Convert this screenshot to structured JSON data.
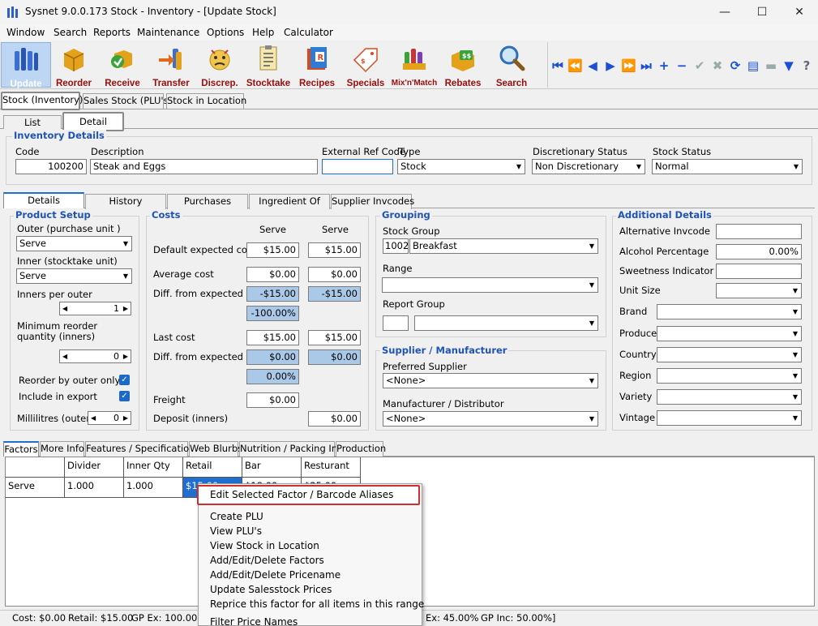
{
  "window": {
    "title": "Sysnet 9.0.0.173 Stock - Inventory - [Update Stock]"
  },
  "menu": [
    "Window",
    "Search",
    "Reports",
    "Maintenance",
    "Options",
    "Help",
    "Calculator"
  ],
  "toolbar": [
    {
      "label": "Update",
      "icon": "update-icon"
    },
    {
      "label": "Reorder",
      "icon": "reorder-icon"
    },
    {
      "label": "Receive",
      "icon": "receive-icon"
    },
    {
      "label": "Transfer",
      "icon": "transfer-icon"
    },
    {
      "label": "Discrep.",
      "icon": "discrepancy-icon"
    },
    {
      "label": "Stocktake",
      "icon": "stocktake-icon"
    },
    {
      "label": "Recipes",
      "icon": "recipes-icon"
    },
    {
      "label": "Specials",
      "icon": "specials-icon"
    },
    {
      "label": "Mix'n'Match",
      "icon": "mixnmatch-icon"
    },
    {
      "label": "Rebates",
      "icon": "rebates-icon"
    },
    {
      "label": "Search",
      "icon": "search-icon"
    }
  ],
  "nav_icons": [
    "first-icon",
    "prev-page-icon",
    "prev-icon",
    "next-icon",
    "next-page-icon",
    "last-icon",
    "add-icon",
    "delete-icon",
    "confirm-icon",
    "cancel-icon",
    "refresh-icon",
    "book-icon",
    "notes-icon",
    "filter-icon",
    "help-icon"
  ],
  "main_tabs": [
    "Stock (Inventory)",
    "Sales Stock (PLU's)",
    "Stock in Location"
  ],
  "sub_tabs": [
    "List",
    "Detail"
  ],
  "inventory_details": {
    "title": "Inventory Details",
    "code_label": "Code",
    "code": "100200",
    "desc_label": "Description",
    "desc": "Steak and Eggs",
    "extref_label": "External Ref Code",
    "extref": "",
    "type_label": "Type",
    "type": "Stock",
    "disc_label": "Discretionary Status",
    "disc": "Non Discretionary",
    "status_label": "Stock Status",
    "status": "Normal"
  },
  "detail_tabs": [
    "Details",
    "History",
    "Purchases",
    "Ingredient Of",
    "Supplier Invcodes"
  ],
  "product_setup": {
    "title": "Product Setup",
    "outer_label": "Outer (purchase unit )",
    "outer": "Serve",
    "inner_label": "Inner (stocktake unit)",
    "inner": "Serve",
    "inners_label": "Inners per outer",
    "inners": "1",
    "minreorder_label1": "Minimum reorder",
    "minreorder_label2": "quantity (inners)",
    "minreorder": "0",
    "reorder_outer_label": "Reorder by outer only",
    "include_export_label": "Include in export",
    "ml_label": "Millilitres (outer)",
    "ml": "0"
  },
  "costs": {
    "title": "Costs",
    "col1": "Serve",
    "col2": "Serve",
    "default_label": "Default expected cost",
    "default1": "$15.00",
    "default2": "$15.00",
    "avg_label": "Average cost",
    "avg1": "$0.00",
    "avg2": "$0.00",
    "diff1_label": "Diff. from expected",
    "diff1a": "-$15.00",
    "diff1b": "-$15.00",
    "diff1pct": "-100.00%",
    "last_label": "Last cost",
    "last1": "$15.00",
    "last2": "$15.00",
    "diff2_label": "Diff. from expected",
    "diff2a": "$0.00",
    "diff2b": "$0.00",
    "diff2pct": "0.00%",
    "freight_label": "Freight",
    "freight": "$0.00",
    "deposit_label": "Deposit (inners)",
    "deposit": "$0.00"
  },
  "grouping": {
    "title": "Grouping",
    "stockgroup_label": "Stock Group",
    "stockgroup_code": "1002",
    "stockgroup": "Breakfast",
    "range_label": "Range",
    "range": "",
    "reportgroup_label": "Report Group"
  },
  "supplier": {
    "title": "Supplier / Manufacturer",
    "pref_label": "Preferred Supplier",
    "pref": "<None>",
    "manuf_label": "Manufacturer / Distributor",
    "manuf": "<None>"
  },
  "additional": {
    "title": "Additional Details",
    "alt_label": "Alternative Invcode",
    "alcohol_label": "Alcohol Percentage",
    "alcohol": "0.00%",
    "sweet_label": "Sweetness Indicator",
    "unitsize_label": "Unit Size",
    "brand_label": "Brand",
    "producer_label": "Producer",
    "country_label": "Country",
    "region_label": "Region",
    "variety_label": "Variety",
    "vintage_label": "Vintage"
  },
  "bottom_tabs": [
    "Factors",
    "More Info",
    "Features / Specifications",
    "Web Blurbs",
    "Nutrition / Packing Info",
    "Production"
  ],
  "factors_grid": {
    "headers": [
      "",
      "Divider",
      "Inner Qty",
      "Retail",
      "Bar",
      "Resturant"
    ],
    "row": [
      "Serve",
      "1.000",
      "1.000",
      "$15.00",
      "$18.00",
      "$25.00"
    ]
  },
  "context_menu": [
    "Edit Selected Factor / Barcode Aliases",
    "Create PLU",
    "View PLU's",
    "View Stock in Location",
    "Add/Edit/Delete Factors",
    "Add/Edit/Delete Pricename",
    "Update Salesstock Prices",
    "Reprice this factor for all items in this range",
    "Filter Price Names"
  ],
  "status": {
    "cost": "Cost: $0.00",
    "retail": "Retail: $15.00",
    "gpex": "GP Ex: 100.00%",
    "ex2": "Ex: 45.00%",
    "gpinc": "GP Inc: 50.00%]"
  }
}
